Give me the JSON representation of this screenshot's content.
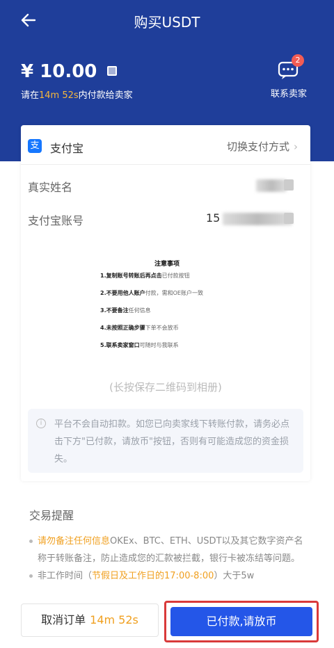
{
  "nav": {
    "title": "购买USDT"
  },
  "order": {
    "price": "¥ 10.00",
    "pay_note_prefix": "请在",
    "pay_note_time": "14m 52s",
    "pay_note_suffix": "内付款给卖家"
  },
  "contact": {
    "label": "联系卖家",
    "badge": "2"
  },
  "payment": {
    "method": "支付宝",
    "switch_label": "切换支付方式",
    "real_name_label": "真实姓名",
    "account_label": "支付宝账号",
    "account_prefix": "15"
  },
  "notice": {
    "title": "注意事项",
    "items": [
      {
        "bold": "1.复制账号转账后再点击",
        "rest": "已付款按钮"
      },
      {
        "bold": "2.不要用他人账户",
        "rest": "付款，需和OE账户一致"
      },
      {
        "bold": "3.不要备注",
        "rest": "任何信息"
      },
      {
        "bold": "4.未按照正确步骤",
        "rest": "下单不会放币"
      },
      {
        "bold": "5.联系卖家窗口",
        "rest": "可随时与我联系"
      }
    ]
  },
  "save_hint": "(长按保存二维码到相册)",
  "warning": {
    "text": "平台不会自动扣款。如您已向卖家线下转账付款，请务必点击下方\"已付款，请放币\"按钮，否则有可能造成您的资金损失。"
  },
  "tips": {
    "title": "交易提醒",
    "item1_highlight": "请勿备注任何信息",
    "item1_rest": "OKEx、BTC、ETH、USDT以及其它数字资产名称于转账备注，防止造成您的汇款被拦截，银行卡被冻结等问题。",
    "item2_prefix": "非工作时间（",
    "item2_highlight": "节假日及工作日的17:00-8:00",
    "item2_rest": "）大于5w"
  },
  "bottom": {
    "cancel_label": "取消订单",
    "cancel_timer": "14m 52s",
    "confirm_label": "已付款,请放币"
  },
  "colors": {
    "header_bg": "#1f3e9a",
    "primary_button": "#2456e8",
    "accent_orange": "#f0a020",
    "highlight_frame": "#d93a3a"
  }
}
